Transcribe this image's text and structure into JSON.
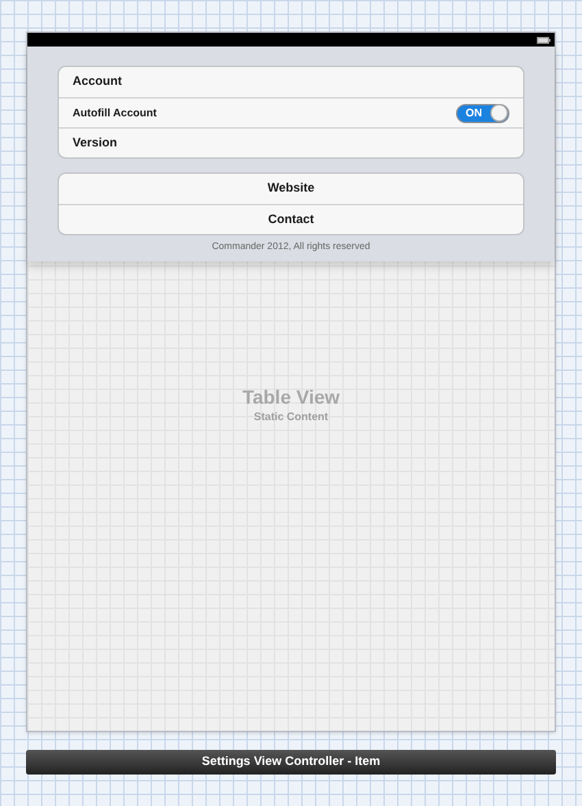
{
  "settings_group": [
    {
      "kind": "label",
      "label": "Account"
    },
    {
      "kind": "switch",
      "label": "Autofill Account",
      "on": true,
      "switch_text": "ON"
    },
    {
      "kind": "label",
      "label": "Version"
    }
  ],
  "links_group": [
    {
      "label": "Website"
    },
    {
      "label": "Contact"
    }
  ],
  "footer_text": "Commander 2012, All rights reserved",
  "placeholder": {
    "title": "Table View",
    "subtitle": "Static Content"
  },
  "scene_bar": {
    "title": "Settings View Controller - Item"
  }
}
